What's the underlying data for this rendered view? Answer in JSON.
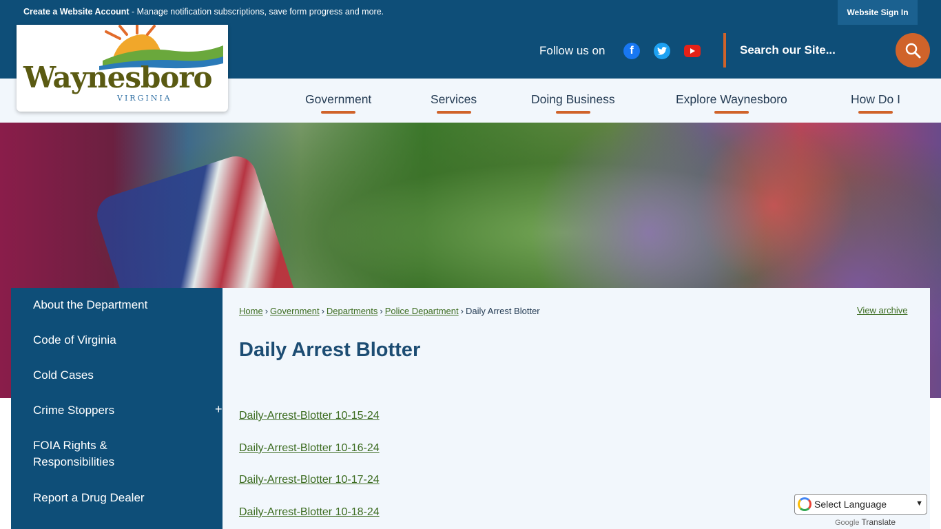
{
  "topbar": {
    "account_strong": "Create a Website Account",
    "account_rest": " - Manage notification subscriptions, save form progress and more.",
    "signin_label": "Website Sign In"
  },
  "header": {
    "follow_label": "Follow us on",
    "search_placeholder": "Search our Site...",
    "social_icons": [
      "facebook-icon",
      "twitter-icon",
      "youtube-icon"
    ]
  },
  "logo": {
    "name": "Waynesboro",
    "sub": "VIRGINIA"
  },
  "nav": {
    "items": [
      "Government",
      "Services",
      "Doing Business",
      "Explore Waynesboro",
      "How Do I"
    ]
  },
  "sidebar": {
    "items": [
      "About the Department",
      "Code of Virginia",
      "Cold Cases",
      "Crime Stoppers",
      "FOIA Rights &",
      "Responsibilities",
      "Report a Drug Dealer"
    ],
    "toggle": "+"
  },
  "breadcrumb": {
    "items": [
      "Home",
      "Government",
      "Departments",
      "Police Department"
    ],
    "current": "Daily Arrest Blotter",
    "separator": "›"
  },
  "main": {
    "title": "Daily Arrest Blotter",
    "view_archive": "View archive",
    "documents": [
      "Daily-Arrest-Blotter 10-15-24",
      "Daily-Arrest-Blotter 10-16-24",
      "Daily-Arrest-Blotter 10-17-24",
      "Daily-Arrest-Blotter 10-18-24"
    ]
  },
  "translate": {
    "select_label": "Select Language",
    "powered_google": "Google",
    "powered_translate": "Translate"
  },
  "colors": {
    "primary": "#0e4e78",
    "accent": "#d0632a",
    "link": "#3b6b1f",
    "title": "#1d4d73",
    "content_bg": "#f2f7fc"
  }
}
